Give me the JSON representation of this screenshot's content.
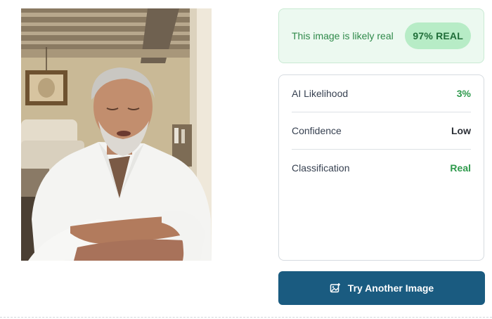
{
  "verdict": {
    "message": "This image is likely real",
    "badge": "97% REAL",
    "real_percent": 97
  },
  "details": {
    "rows": [
      {
        "label": "AI Likelihood",
        "value": "3%"
      },
      {
        "label": "Confidence",
        "value": "Low"
      },
      {
        "label": "Classification",
        "value": "Real"
      }
    ]
  },
  "actions": {
    "try_another_label": "Try Another Image",
    "try_another_icon": "image-upload-icon"
  },
  "colors": {
    "accent_green": "#2e9a4c",
    "banner_bg": "#ecf9f0",
    "badge_bg": "#b7ecc6",
    "button_bg": "#1a5b80"
  }
}
